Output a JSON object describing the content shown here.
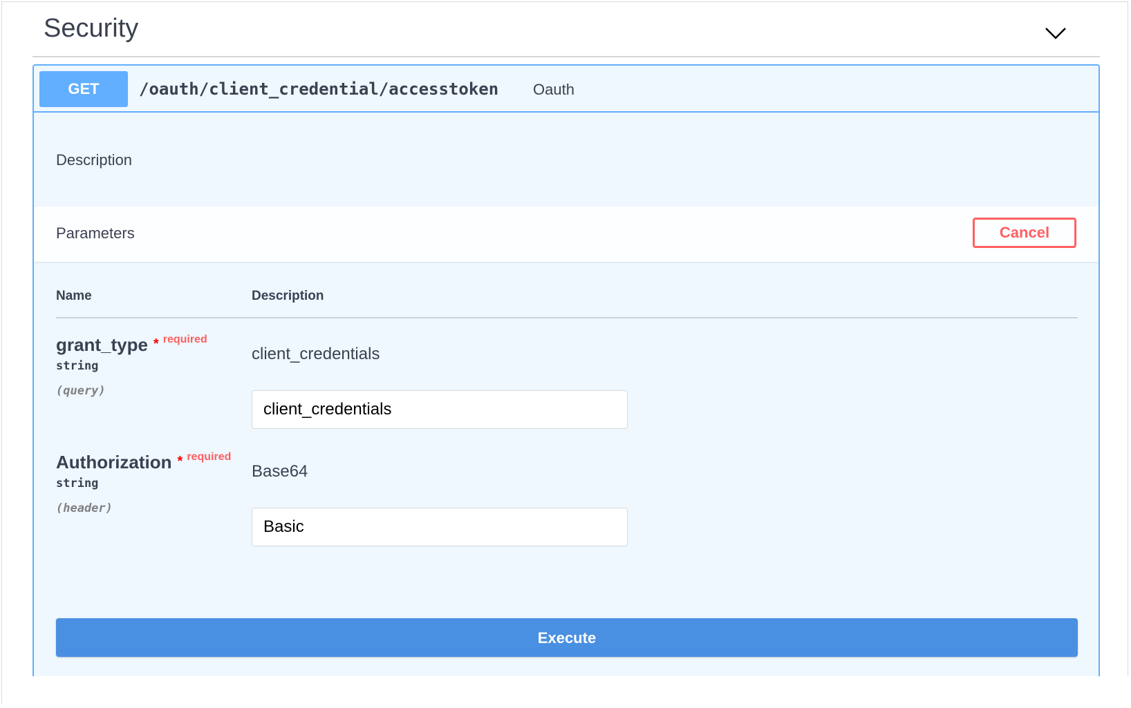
{
  "section": {
    "title": "Security",
    "toggle_icon": "chevron-down-icon"
  },
  "operation": {
    "method": "GET",
    "path": "/oauth/client_credential/accesstoken",
    "summary": "Oauth",
    "method_color": "#61affe",
    "description_label": "Description",
    "parameters_label": "Parameters",
    "cancel_label": "Cancel",
    "cancel_color": "#ff6060",
    "execute_label": "Execute",
    "execute_color": "#4990e2"
  },
  "params_table": {
    "headers": {
      "name": "Name",
      "description": "Description"
    },
    "rows": [
      {
        "name": "grant_type",
        "required_star": "*",
        "required_label": "required",
        "type": "string",
        "in": "(query)",
        "description": "client_credentials",
        "value": "client_credentials"
      },
      {
        "name": "Authorization",
        "required_star": "*",
        "required_label": "required",
        "type": "string",
        "in": "(header)",
        "description": "Base64",
        "value": "Basic"
      }
    ]
  }
}
